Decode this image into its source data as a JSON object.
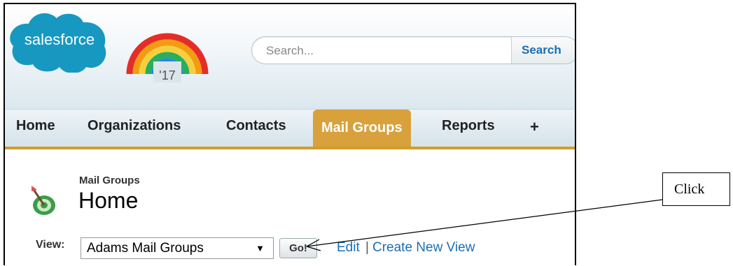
{
  "logo": {
    "text": "salesforce",
    "badge": "'17"
  },
  "search": {
    "placeholder": "Search...",
    "button_label": "Search"
  },
  "tabs": [
    {
      "label": "Home"
    },
    {
      "label": "Organizations"
    },
    {
      "label": "Contacts"
    },
    {
      "label": "Mail Groups",
      "active": true
    },
    {
      "label": "Reports"
    },
    {
      "label": "+"
    }
  ],
  "page": {
    "subtitle": "Mail Groups",
    "title": "Home"
  },
  "view": {
    "label": "View:",
    "selected": "Adams Mail Groups",
    "arrow": "▼",
    "go_label": "Go!",
    "edit_label": "Edit",
    "separator": "|",
    "create_label": "Create New View"
  },
  "annotation": {
    "text": "Click"
  },
  "colors": {
    "brand_blue": "#1798c1",
    "active_tab": "#d8a13c",
    "link": "#1a6fb5"
  }
}
